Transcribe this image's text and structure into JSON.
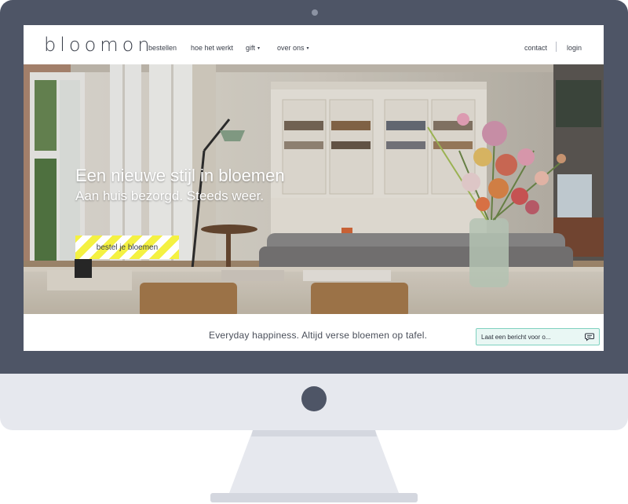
{
  "site": {
    "logo": "bloomon"
  },
  "nav": {
    "items": [
      {
        "label": "bestellen"
      },
      {
        "label": "hoe het werkt"
      },
      {
        "label": "gift",
        "caret": "▾"
      },
      {
        "label": "over ons",
        "caret": "▾"
      }
    ],
    "right": {
      "contact": "contact",
      "login": "login"
    }
  },
  "hero": {
    "headline": "Een nieuwe stijl in bloemen",
    "subline": "Aan huis bezorgd. Steeds weer.",
    "cta_label": "bestel je bloemen"
  },
  "tagline": "Everyday happiness. Altijd verse bloemen op tafel.",
  "chat": {
    "label": "Laat een bericht voor o..."
  },
  "icons": {
    "chat": "chat-bubble-icon",
    "camera": "camera-icon",
    "home": "home-button-icon"
  },
  "colors": {
    "frame": "#4e5566",
    "chin": "#e6e8ee",
    "cta_stripe": "#f4f142",
    "chat_bg": "#e9f7f4",
    "chat_border": "#7fd1bf",
    "text_dark": "#3a3f4a"
  }
}
